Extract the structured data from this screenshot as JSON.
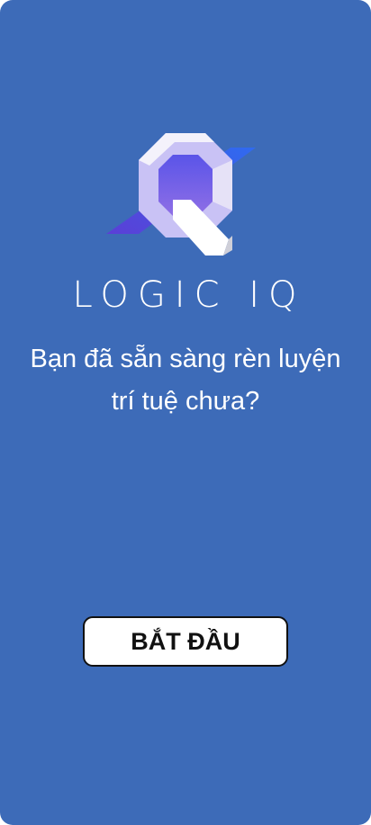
{
  "app": {
    "brand_name": "LOGIC IQ",
    "logo_icon": "logic-iq-q-logo-icon"
  },
  "welcome": {
    "tagline": "Bạn đã sẵn sàng rèn luyện trí tuệ chưa?"
  },
  "actions": {
    "start_label": "BẮT ĐẦU"
  },
  "colors": {
    "background": "#3d6bb8",
    "text": "#ffffff",
    "button_bg": "#ffffff",
    "button_text": "#111111",
    "logo_purple": "#7b68e8",
    "logo_lavender": "#c9c2f5"
  }
}
